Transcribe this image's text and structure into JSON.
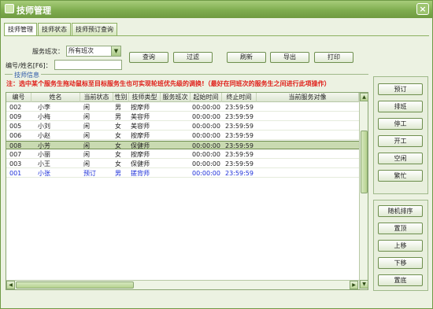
{
  "window": {
    "title": "技师管理",
    "close_label": "×"
  },
  "tabs": [
    "技师管理",
    "技师状态",
    "技师预订查询"
  ],
  "filters": {
    "shift_label": "服务班次：",
    "shift_value": "所有班次",
    "id_name_label": "编号/姓名[F6]：",
    "id_name_value": ""
  },
  "toolbar": {
    "query": "查询",
    "filter": "过滤",
    "refresh": "刷新",
    "export": "导出",
    "print": "打印"
  },
  "group_title": "技师信息",
  "notice": "注：选中某个服务生拖动鼠标至目标服务生也可实现轮班优先级的调换!（最好在同班次的服务生之间进行此项操作）",
  "table": {
    "columns": [
      "编号",
      "姓名",
      "当前状态",
      "性别",
      "技师类型",
      "服务班次",
      "起始时间",
      "终止时间",
      "当前服务对像"
    ],
    "rows": [
      {
        "id": "002",
        "name": "小李",
        "status": "闲",
        "gender": "男",
        "type": "按摩师",
        "shift": "",
        "start": "00:00:00",
        "end": "23:59:59",
        "client": ""
      },
      {
        "id": "009",
        "name": "小梅",
        "status": "闲",
        "gender": "男",
        "type": "美容师",
        "shift": "",
        "start": "00:00:00",
        "end": "23:59:59",
        "client": ""
      },
      {
        "id": "005",
        "name": "小刘",
        "status": "闲",
        "gender": "女",
        "type": "美容师",
        "shift": "",
        "start": "00:00:00",
        "end": "23:59:59",
        "client": ""
      },
      {
        "id": "006",
        "name": "小赵",
        "status": "闲",
        "gender": "女",
        "type": "按摩师",
        "shift": "",
        "start": "00:00:00",
        "end": "23:59:59",
        "client": ""
      },
      {
        "id": "008",
        "name": "小芳",
        "status": "闲",
        "gender": "女",
        "type": "保健师",
        "shift": "",
        "start": "00:00:00",
        "end": "23:59:59",
        "client": ""
      },
      {
        "id": "007",
        "name": "小丽",
        "status": "闲",
        "gender": "女",
        "type": "按摩师",
        "shift": "",
        "start": "00:00:00",
        "end": "23:59:59",
        "client": ""
      },
      {
        "id": "003",
        "name": "小王",
        "status": "闲",
        "gender": "女",
        "type": "保健师",
        "shift": "",
        "start": "00:00:00",
        "end": "23:59:59",
        "client": ""
      },
      {
        "id": "001",
        "name": "小张",
        "status": "预订",
        "gender": "男",
        "type": "搓背师",
        "shift": "",
        "start": "00:00:00",
        "end": "23:59:59",
        "client": ""
      }
    ]
  },
  "side_actions": [
    "预订",
    "排班",
    "停工",
    "开工",
    "空闲",
    "繁忙"
  ],
  "side_order": [
    "随机排序",
    "置顶",
    "上移",
    "下移",
    "置底"
  ],
  "colors": {
    "accent_green": "#7fad4f",
    "notice_red": "#e0201a",
    "reserved_blue": "#1c2fd8",
    "selected_row": "#c9dab1"
  }
}
